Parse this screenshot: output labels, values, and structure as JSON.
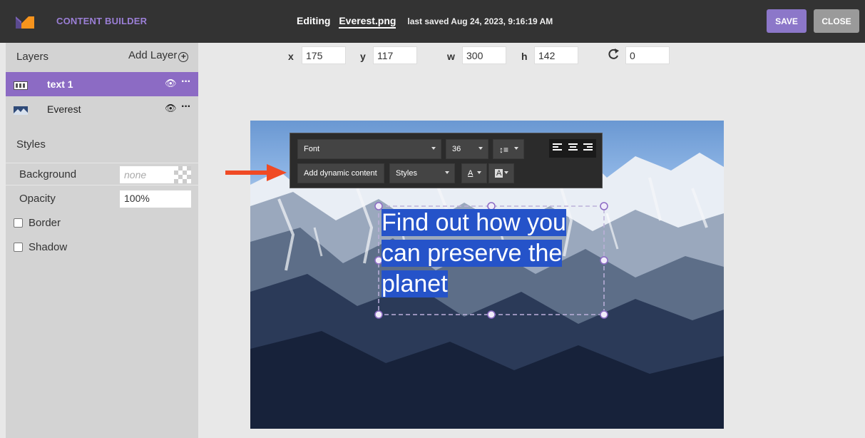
{
  "header": {
    "app_name": "CONTENT BUILDER",
    "editing_label": "Editing",
    "file_name": "Everest.png",
    "last_saved": "last saved Aug 24, 2023, 9:16:19 AM",
    "save_label": "SAVE",
    "close_label": "CLOSE"
  },
  "colors": {
    "topbar": "#333333",
    "accent": "#8c6bc4",
    "save_button": "#8c77c9",
    "close_button": "#9a9a9a",
    "sidebar": "#d3d3d3",
    "text_highlight": "#2553c9",
    "arrow": "#f04a24"
  },
  "layers_panel": {
    "title": "Layers",
    "add_label": "Add Layer",
    "add_icon": "plus-circle-icon",
    "layers": [
      {
        "name": "text 1",
        "selected": true,
        "icon": "text-layer-icon"
      },
      {
        "name": "Everest",
        "selected": false,
        "icon": "image-layer-icon"
      }
    ]
  },
  "styles_panel": {
    "title": "Styles",
    "background_label": "Background",
    "background_placeholder": "none",
    "opacity_label": "Opacity",
    "opacity_value": "100%",
    "border_label": "Border",
    "border_checked": false,
    "shadow_label": "Shadow",
    "shadow_checked": false
  },
  "geometry": {
    "x_label": "x",
    "x_value": "175",
    "y_label": "y",
    "y_value": "117",
    "w_label": "w",
    "w_value": "300",
    "h_label": "h",
    "h_value": "142",
    "rotate_icon": "rotate-icon",
    "rotation_value": "0"
  },
  "text_toolbar": {
    "font_value": "Font",
    "size_value": "36",
    "line_height_icon": "line-height-icon",
    "align_icons": [
      "align-left-icon",
      "align-center-icon",
      "align-right-icon"
    ],
    "dynamic_content_label": "Add dynamic content",
    "styles_value": "Styles",
    "text_color_glyph": "A",
    "highlight_glyph": "A"
  },
  "canvas": {
    "text_lines": [
      "Find out how you",
      "can preserve the",
      "planet"
    ]
  }
}
